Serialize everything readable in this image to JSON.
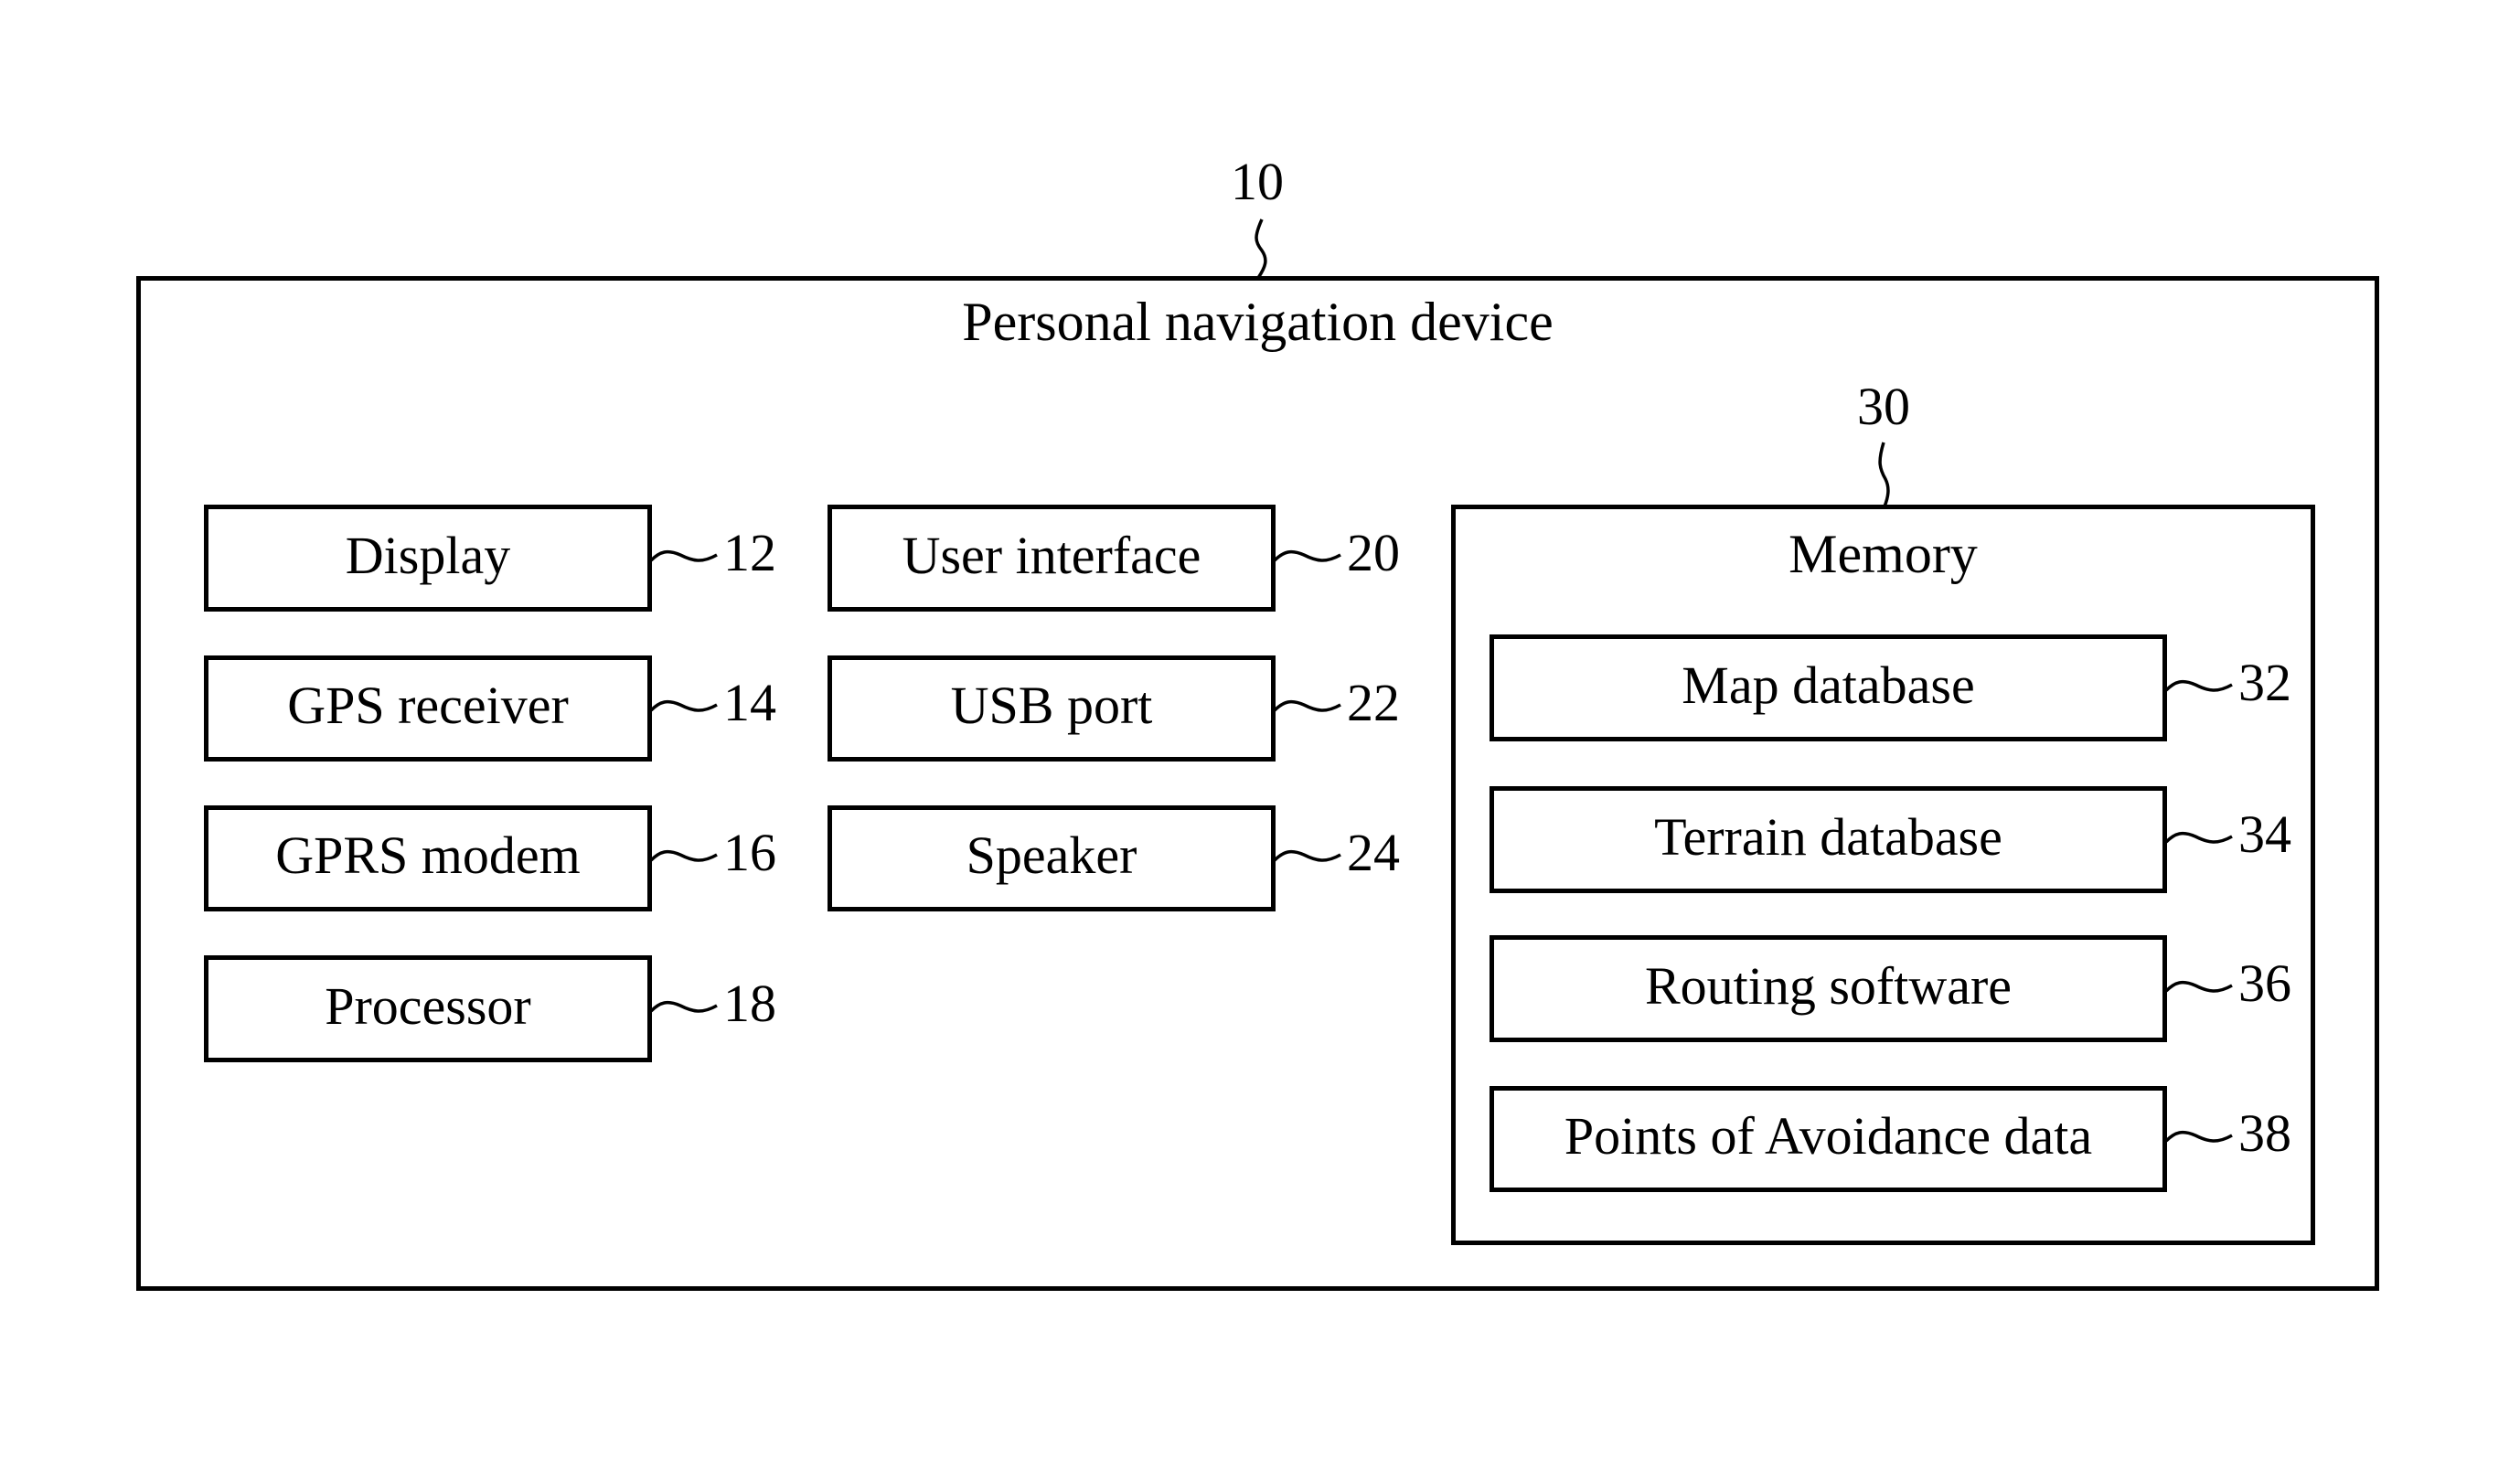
{
  "diagram": {
    "device": {
      "ref": "10",
      "title": "Personal navigation device"
    },
    "components": [
      {
        "id": "b-display",
        "label": "Display",
        "ref": "12"
      },
      {
        "id": "b-gps",
        "label": "GPS receiver",
        "ref": "14"
      },
      {
        "id": "b-gprs",
        "label": "GPRS modem",
        "ref": "16"
      },
      {
        "id": "b-processor",
        "label": "Processor",
        "ref": "18"
      },
      {
        "id": "b-ui",
        "label": "User interface",
        "ref": "20"
      },
      {
        "id": "b-usb",
        "label": "USB port",
        "ref": "22"
      },
      {
        "id": "b-speaker",
        "label": "Speaker",
        "ref": "24"
      }
    ],
    "memory": {
      "ref": "30",
      "title": "Memory",
      "items": [
        {
          "id": "b-map",
          "label": "Map database",
          "ref": "32"
        },
        {
          "id": "b-terrain",
          "label": "Terrain database",
          "ref": "34"
        },
        {
          "id": "b-routing",
          "label": "Routing software",
          "ref": "36"
        },
        {
          "id": "b-poa",
          "label": "Points of Avoidance data",
          "ref": "38"
        }
      ]
    }
  },
  "colors": {
    "stroke": "#000000",
    "background": "#ffffff"
  }
}
